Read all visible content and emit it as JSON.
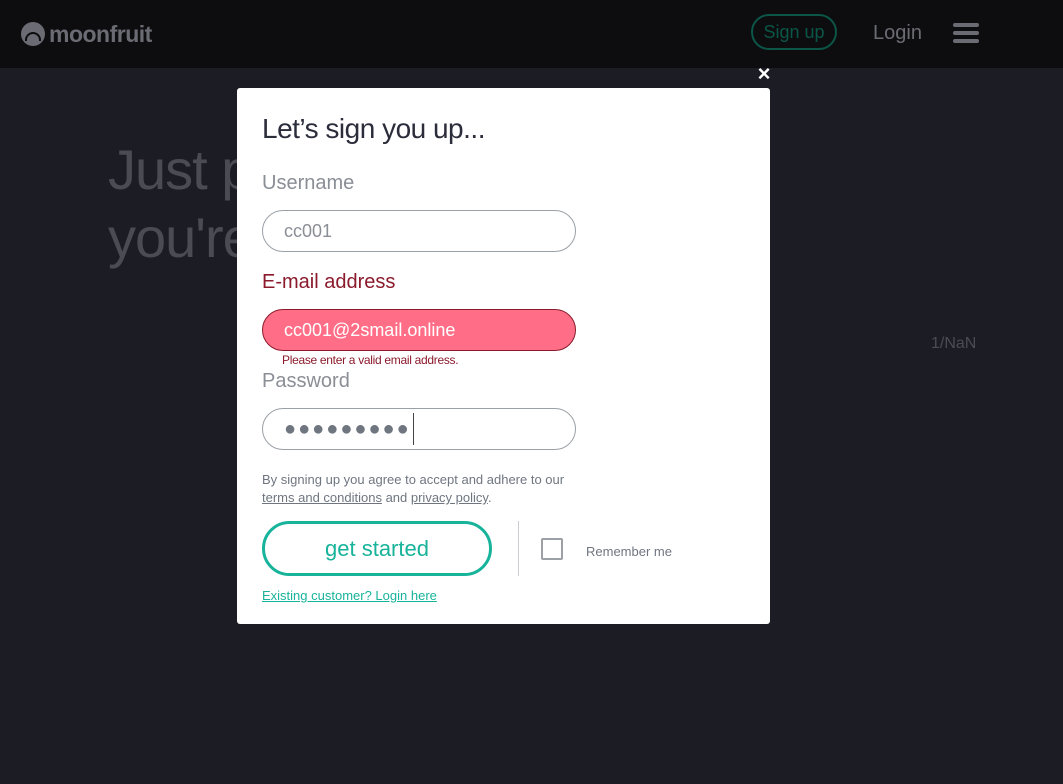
{
  "header": {
    "logo_text": "moonfruit",
    "signup_label": "Sign up",
    "login_label": "Login"
  },
  "hero": {
    "line1": "Just pi",
    "line2": "you're"
  },
  "pager": "1/NaN",
  "modal": {
    "close_glyph": "×",
    "title": "Let’s sign you up...",
    "username": {
      "label": "Username",
      "value": "cc001"
    },
    "email": {
      "label": "E-mail address",
      "value": "cc001@2smail.online",
      "error": "Please enter a valid email address."
    },
    "password": {
      "label": "Password",
      "masked": "●●●●●●●●●"
    },
    "terms": {
      "prefix": "By signing up you agree to accept and adhere to our ",
      "terms_link": "terms and conditions",
      "middle": " and ",
      "privacy_link": "privacy policy",
      "suffix": "."
    },
    "submit_label": "get started",
    "remember_label": "Remember me",
    "remember_checked": false,
    "existing_link": "Existing customer? Login here"
  },
  "colors": {
    "accent": "#17b39a",
    "error_bg": "#ff6e86",
    "error_text": "#8b1a2c",
    "title": "#2b2d3b"
  }
}
